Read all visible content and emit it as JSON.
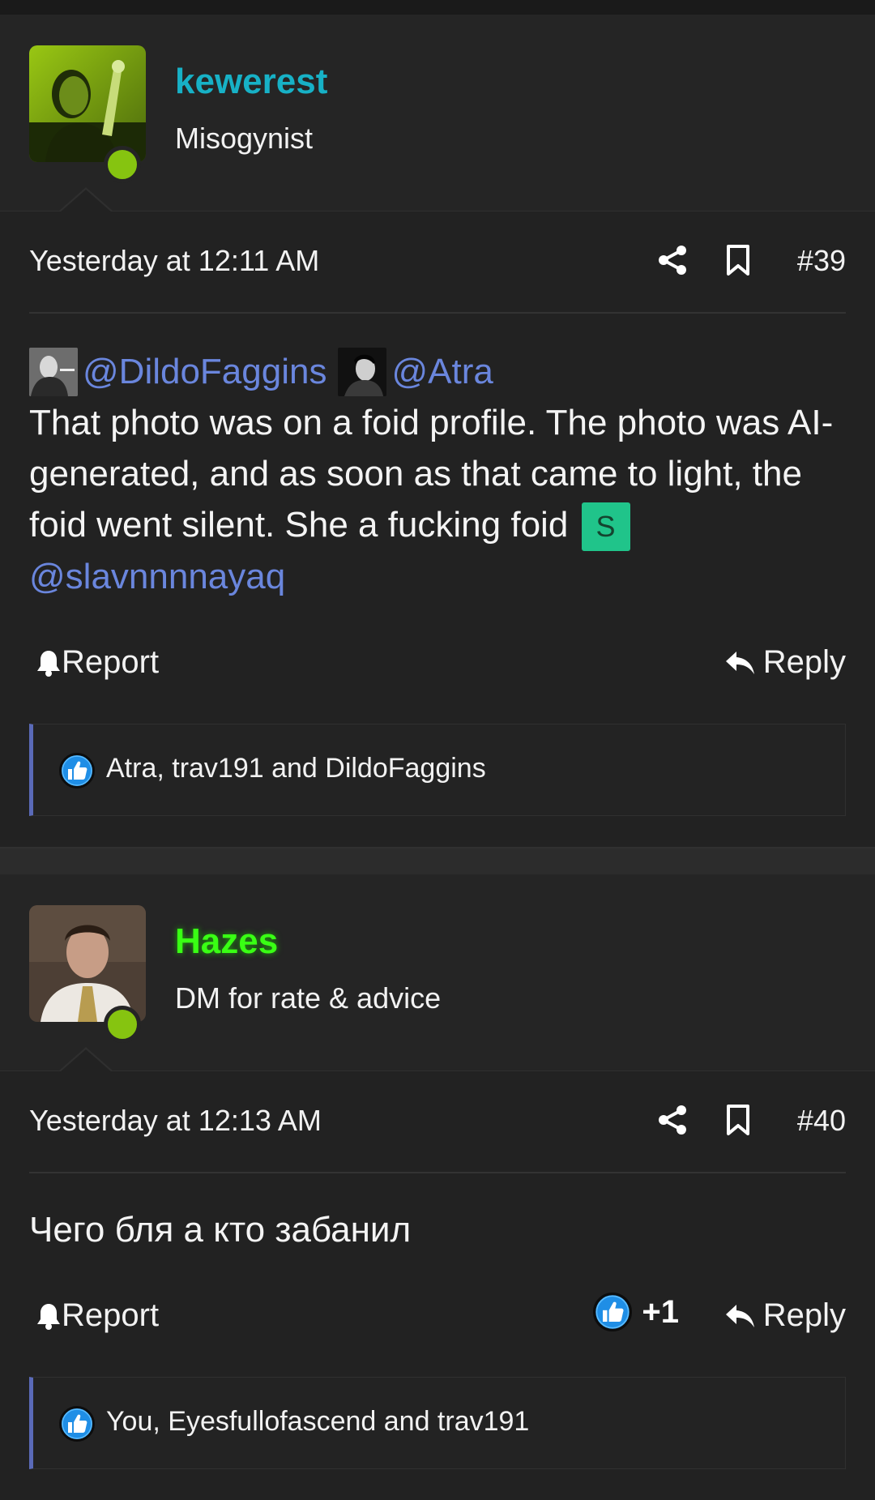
{
  "colors": {
    "bg": "#242424",
    "mention": "#6a86dd",
    "kewerest": "#17b1c6",
    "hazes": "#39ff14",
    "online": "#86c410",
    "reaction_border": "#5a6ab8"
  },
  "posts": [
    {
      "username": "kewerest",
      "user_title": "Misogynist",
      "timestamp": "Yesterday at 12:11 AM",
      "post_number": "#39",
      "mentions": [
        "@DildoFaggins",
        "@Atra"
      ],
      "message_text": "That photo was on a foid profile. The photo was AI-generated, and as soon as that came to light, the foid went silent. She a fucking foid",
      "badge": "S",
      "trailing_mention": "@slavnnnnayaq",
      "report_label": "Report",
      "reply_label": "Reply",
      "reactions": "Atra, trav191 and DildoFaggins"
    },
    {
      "username": "Hazes",
      "user_title": "DM for rate & advice",
      "timestamp": "Yesterday at 12:13 AM",
      "post_number": "#40",
      "message_text": "Чего бля а кто забанил",
      "report_label": "Report",
      "reply_label": "Reply",
      "reaction_count": "+1",
      "reactions": "You, Eyesfullofascend and trav191"
    }
  ]
}
